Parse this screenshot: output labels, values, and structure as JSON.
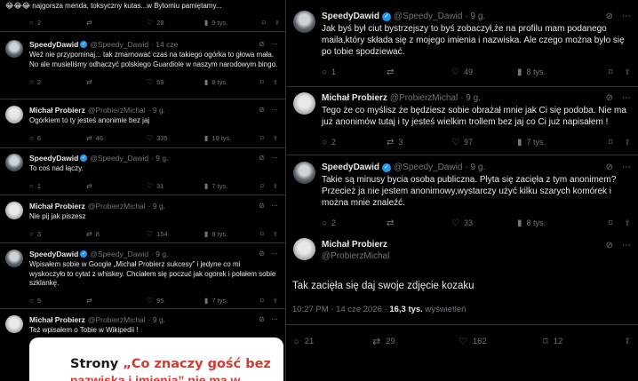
{
  "left": {
    "top_partial": {
      "text": "😂😂😂 najgorsza menda, toksyczny kutas...w Bytomiu pamiętamy...",
      "replies": "2",
      "reposts": "",
      "likes": "28",
      "views": "9 tys."
    },
    "tweets": [
      {
        "name": "SpeedyDawid",
        "handle": "@Speedy_Dawid",
        "time": "· 14 cze",
        "verified": true,
        "text": "Weź nie przypominaj... tak zmarnować czas na takiego ogórka to głowa mała. No ale musieliśmy odhaczyć polskiego Guardiole w naszym narodowym bingo.",
        "replies": "2",
        "reposts": "",
        "likes": "59",
        "views": "8 tys."
      },
      {
        "name": "Michał Probierz",
        "handle": "@ProbierzMichal",
        "time": "· 9 g.",
        "verified": false,
        "text": "Ogórkiem to ty jesteś anonimie bez jaj",
        "replies": "6",
        "reposts": "46",
        "likes": "335",
        "views": "19 tys."
      },
      {
        "name": "SpeedyDawid",
        "handle": "@Speedy_Dawid",
        "time": "· 9 g.",
        "verified": true,
        "text": "To coś nad łączy.",
        "replies": "1",
        "reposts": "",
        "likes": "31",
        "views": "7 tys."
      },
      {
        "name": "Michał Probierz",
        "handle": "@ProbierzMichal",
        "time": "· 9 g.",
        "verified": false,
        "text": "Nie pij jak piszesz",
        "replies": "3",
        "reposts": "8",
        "likes": "154",
        "views": "8 tys."
      },
      {
        "name": "SpeedyDawid",
        "handle": "@Speedy_Dawid",
        "time": "· 9 g.",
        "verified": true,
        "text": "Wpisałem sobie w Google „Michał Probierz sukcesy” i jedyne co mi wyskoczyło to cytat z whiskey. Chciałem się poczuć jak ogorek i połałem sobie szklankę.",
        "replies": "5",
        "reposts": "",
        "likes": "95",
        "views": "7 tys."
      },
      {
        "name": "Michał Probierz",
        "handle": "@ProbierzMichal",
        "time": "· 9 g.",
        "verified": false,
        "text": "Też wpisałem o Tobie w Wikipedii !",
        "replies": "",
        "reposts": "",
        "likes": "",
        "views": ""
      }
    ],
    "card": {
      "line1_prefix": "Strony ",
      "line1_red": "„Co znaczy gość bez",
      "line2": "nazwiska i imienia” nie ma w"
    }
  },
  "right": {
    "tweets": [
      {
        "name": "SpeedyDawid",
        "handle": "@Speedy_Dawid",
        "time": "· 9 g.",
        "verified": true,
        "text": "Jak byś był ciut bystrzejszy to byś zobaczył,że na profilu mam podanego maila,który składa się z mojego imienia i nazwiska. Ale czego można było się po tobie spodziewać.",
        "replies": "1",
        "reposts": "",
        "likes": "49",
        "views": "8 tys."
      },
      {
        "name": "Michał Probierz",
        "handle": "@ProbierzMichal",
        "time": "· 9 g.",
        "verified": false,
        "text": "Tego że co myślisz że będziesz sobie obrażał mnie jak Ci się podoba. Nie ma już anonimów tutaj i ty jesteś wielkim trollem bez jaj co Ci już napisałem !",
        "replies": "2",
        "reposts": "3",
        "likes": "97",
        "views": "7 tys."
      },
      {
        "name": "SpeedyDawid",
        "handle": "@Speedy_Dawid",
        "time": "· 9 g.",
        "verified": true,
        "text": "Takie są minusy bycia osoba publiczna. Płyta się zacięła z tym anonimem? Przecież ja nie jestem anonimowy,wystarczy użyć kilku szarych komórek i można mnie znaleźć.",
        "replies": "2",
        "reposts": "",
        "likes": "33",
        "views": "8 tys."
      }
    ],
    "main": {
      "name": "Michał Probierz",
      "handle": "@ProbierzMichal",
      "text": "Tak zacięła się daj swoje zdjęcie kozaku",
      "time": "10:27 PM · 14 cze 2026 · ",
      "views_count": "16,3 tys.",
      "views_label": " wyświetleń",
      "replies": "21",
      "reposts": "29",
      "likes": "162",
      "bookmarks": "12"
    }
  },
  "icons": {
    "reply": "💬",
    "repost": "⇄",
    "like": "♡",
    "views": "📊",
    "bookmark": "🔖",
    "share": "⇪",
    "grok": "⊘",
    "more": "⋯"
  }
}
